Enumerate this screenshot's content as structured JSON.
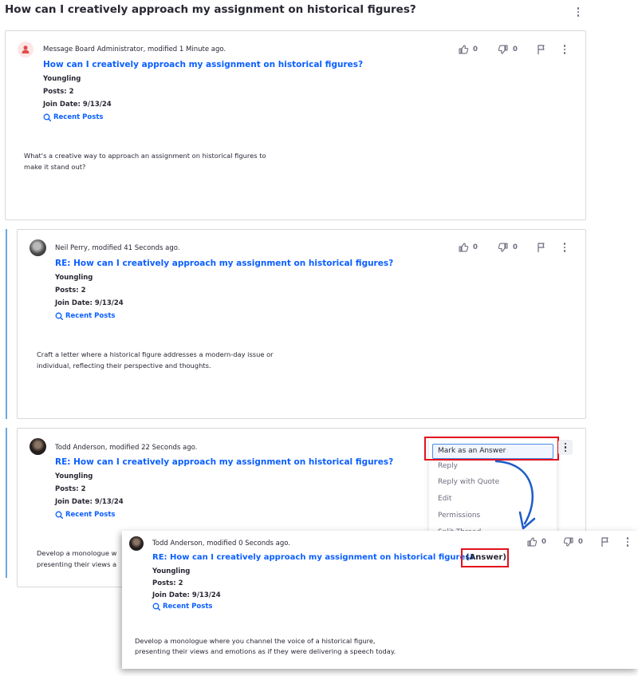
{
  "page": {
    "title": "How can I creatively approach my assignment on historical figures?"
  },
  "icons": {
    "thumbs_up": "thumbs-up-icon",
    "thumbs_down": "thumbs-down-icon",
    "flag": "flag-icon",
    "more": "ellipsis-v-icon",
    "search": "search-icon",
    "user": "user-icon",
    "arrow": "curved-arrow-icon"
  },
  "colors": {
    "link": "#0b5fff",
    "highlight_border": "#e3101c",
    "thread_accent": "#6aa8e0",
    "arrow": "#1e5cc8"
  },
  "posts": [
    {
      "author_line": "Message Board Administrator, modified 1 Minute ago.",
      "title": "How can I creatively approach my assignment on historical figures?",
      "rank": "Youngling",
      "posts": "Posts: 2",
      "join_date": "Join Date: 9/13/24",
      "recent_posts": "Recent Posts",
      "body_lines": [
        "What's a creative way to approach an assignment on historical figures to",
        "make it stand out?"
      ],
      "likes": "0",
      "dislikes": "0"
    },
    {
      "author_line": "Neil Perry, modified 41 Seconds ago.",
      "title": "RE: How can I creatively approach my assignment on historical figures?",
      "rank": "Youngling",
      "posts": "Posts: 2",
      "join_date": "Join Date: 9/13/24",
      "recent_posts": "Recent Posts",
      "body_lines": [
        "Craft a letter where a historical figure addresses a modern-day issue or",
        "individual, reflecting their perspective and thoughts."
      ],
      "likes": "0",
      "dislikes": "0"
    },
    {
      "author_line": "Todd Anderson, modified 22 Seconds ago.",
      "title": "RE: How can I creatively approach my assignment on historical figures?",
      "rank": "Youngling",
      "posts": "Posts: 2",
      "join_date": "Join Date: 9/13/24",
      "recent_posts": "Recent Posts",
      "body_lines": [
        "Develop a monologue w",
        "presenting their views a"
      ]
    }
  ],
  "menu": {
    "items": [
      "Mark as an Answer",
      "Reply",
      "Reply with Quote",
      "Edit",
      "Permissions",
      "Split Thread"
    ]
  },
  "overlay": {
    "author_line": "Todd Anderson, modified 0 Seconds ago.",
    "title": "RE: How can I creatively approach my assignment on historical figures?",
    "answer_tag": "(Answer)",
    "rank": "Youngling",
    "posts": "Posts: 2",
    "join_date": "Join Date: 9/13/24",
    "recent_posts": "Recent Posts",
    "body_lines": [
      "Develop a monologue where you channel the voice of a historical figure,",
      "presenting their views and emotions as if they were delivering a speech today."
    ],
    "likes": "0",
    "dislikes": "0"
  }
}
